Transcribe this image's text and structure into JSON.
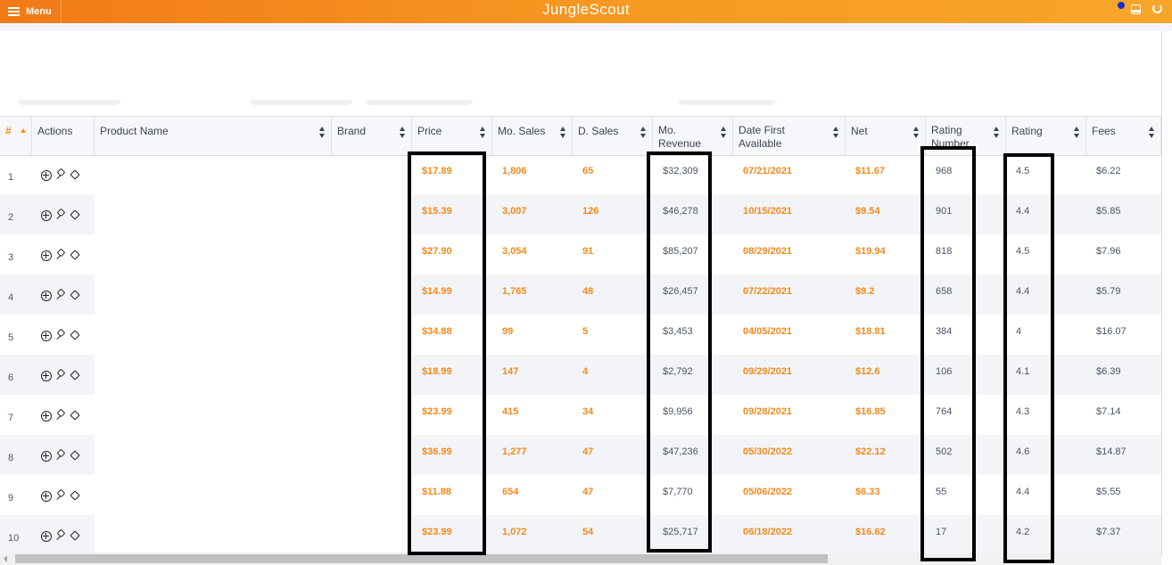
{
  "app": {
    "menu_label": "Menu",
    "brand": "JungleScout"
  },
  "table": {
    "headers": [
      {
        "key": "num",
        "label": "#"
      },
      {
        "key": "actions",
        "label": "Actions"
      },
      {
        "key": "product_name",
        "label": "Product Name"
      },
      {
        "key": "brand",
        "label": "Brand"
      },
      {
        "key": "price",
        "label": "Price"
      },
      {
        "key": "mo_sales",
        "label": "Mo. Sales"
      },
      {
        "key": "d_sales",
        "label": "D. Sales"
      },
      {
        "key": "mo_revenue",
        "label": "Mo. Revenue"
      },
      {
        "key": "date_first",
        "label": "Date First Available"
      },
      {
        "key": "net",
        "label": "Net"
      },
      {
        "key": "rating_number",
        "label": "Rating Number"
      },
      {
        "key": "rating",
        "label": "Rating"
      },
      {
        "key": "fees",
        "label": "Fees"
      }
    ],
    "rows": [
      {
        "num": "1",
        "price": "$17.89",
        "mo_sales": "1,806",
        "d_sales": "65",
        "mo_revenue": "$32,309",
        "date_first": "07/21/2021",
        "net": "$11.67",
        "rating_number": "968",
        "rating": "4.5",
        "fees": "$6.22"
      },
      {
        "num": "2",
        "price": "$15.39",
        "mo_sales": "3,007",
        "d_sales": "126",
        "mo_revenue": "$46,278",
        "date_first": "10/15/2021",
        "net": "$9.54",
        "rating_number": "901",
        "rating": "4.4",
        "fees": "$5.85"
      },
      {
        "num": "3",
        "price": "$27.90",
        "mo_sales": "3,054",
        "d_sales": "91",
        "mo_revenue": "$85,207",
        "date_first": "08/29/2021",
        "net": "$19.94",
        "rating_number": "818",
        "rating": "4.5",
        "fees": "$7.96"
      },
      {
        "num": "4",
        "price": "$14.99",
        "mo_sales": "1,765",
        "d_sales": "48",
        "mo_revenue": "$26,457",
        "date_first": "07/22/2021",
        "net": "$9.2",
        "rating_number": "658",
        "rating": "4.4",
        "fees": "$5.79"
      },
      {
        "num": "5",
        "price": "$34.88",
        "mo_sales": "99",
        "d_sales": "5",
        "mo_revenue": "$3,453",
        "date_first": "04/05/2021",
        "net": "$18.81",
        "rating_number": "384",
        "rating": "4",
        "fees": "$16.07"
      },
      {
        "num": "6",
        "price": "$18.99",
        "mo_sales": "147",
        "d_sales": "4",
        "mo_revenue": "$2,792",
        "date_first": "09/29/2021",
        "net": "$12.6",
        "rating_number": "106",
        "rating": "4.1",
        "fees": "$6.39"
      },
      {
        "num": "7",
        "price": "$23.99",
        "mo_sales": "415",
        "d_sales": "34",
        "mo_revenue": "$9,956",
        "date_first": "09/28/2021",
        "net": "$16.85",
        "rating_number": "764",
        "rating": "4.3",
        "fees": "$7.14"
      },
      {
        "num": "8",
        "price": "$36.99",
        "mo_sales": "1,277",
        "d_sales": "47",
        "mo_revenue": "$47,236",
        "date_first": "05/30/2022",
        "net": "$22.12",
        "rating_number": "502",
        "rating": "4.6",
        "fees": "$14.87"
      },
      {
        "num": "9",
        "price": "$11.88",
        "mo_sales": "654",
        "d_sales": "47",
        "mo_revenue": "$7,770",
        "date_first": "05/06/2022",
        "net": "$6.33",
        "rating_number": "55",
        "rating": "4.4",
        "fees": "$5.55"
      },
      {
        "num": "10",
        "price": "$23.99",
        "mo_sales": "1,072",
        "d_sales": "54",
        "mo_revenue": "$25,717",
        "date_first": "06/18/2022",
        "net": "$16.62",
        "rating_number": "17",
        "rating": "4.2",
        "fees": "$7.37"
      }
    ]
  },
  "row_action_icons": [
    "add-circle-icon",
    "pin-icon",
    "tag-icon"
  ],
  "colors": {
    "header_orange": "#f79a22",
    "value_orange": "#f08a1c",
    "text_gray": "#4a5565",
    "highlight": "#000000",
    "status_dot": "#1a2bd6"
  },
  "highlighted_columns": [
    "price",
    "mo_revenue",
    "rating_number",
    "rating"
  ]
}
